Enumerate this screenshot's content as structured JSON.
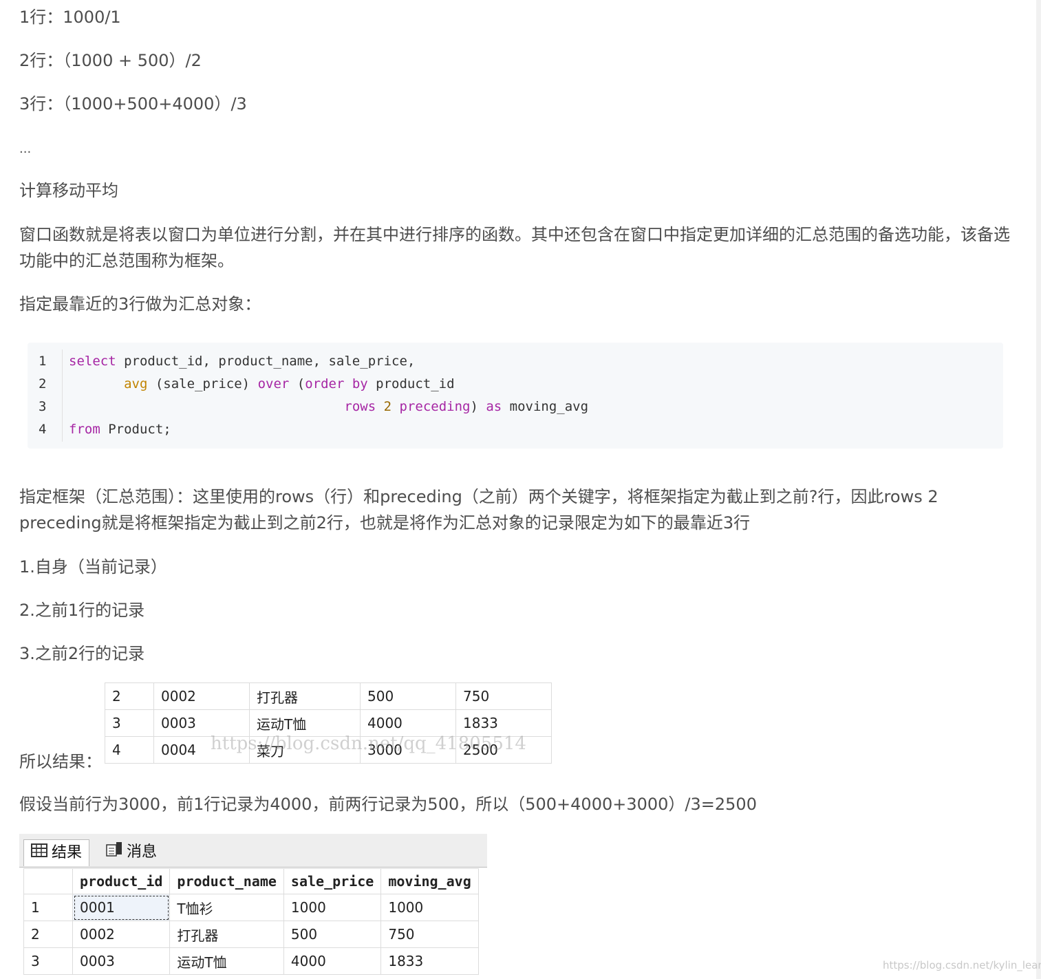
{
  "lines": {
    "l1": "1行：1000/1",
    "l2": "2行：（1000 + 500）/2",
    "l3": "3行：（1000+500+4000）/3",
    "ellipsis": "...",
    "heading": "计算移动平均",
    "para1": "窗口函数就是将表以窗口为单位进行分割，并在其中进行排序的函数。其中还包含在窗口中指定更加详细的汇总范围的备选功能，该备选功能中的汇总范围称为框架。",
    "intro": "指定最靠近的3行做为汇总对象：",
    "para2": "指定框架（汇总范围）：这里使用的rows（行）和preceding（之前）两个关键字，将框架指定为截止到之前?行，因此rows 2 preceding就是将框架指定为截止到之前2行，也就是将作为汇总对象的记录限定为如下的最靠近3行",
    "item1": "1.自身（当前记录）",
    "item2": "2.之前1行的记录",
    "item3": "3.之前2行的记录",
    "result_label": "所以结果：",
    "explain": "假设当前行为3000，前1行记录为4000，前两行记录为500，所以（500+4000+3000）/3=2500"
  },
  "code": {
    "line_numbers": [
      "1",
      "2",
      "3",
      "4"
    ],
    "l1_kw": "select",
    "l1_rest": " product_id, product_name, sale_price,",
    "l2_indent": "       ",
    "l2_fn": "avg",
    "l2_mid": " (sale_price) ",
    "l2_over": "over",
    "l2_paren": " (",
    "l2_order": "order by",
    "l2_rest": " product_id",
    "l3_indent": "                                   ",
    "l3_rows": "rows",
    "l3_sp": " ",
    "l3_num": "2",
    "l3_sp2": " ",
    "l3_prec": "preceding",
    "l3_mid": ") ",
    "l3_as": "as",
    "l3_rest": " moving_avg",
    "l4_kw": "from",
    "l4_rest": " Product;"
  },
  "small_table": {
    "rows": [
      [
        "2",
        "0002",
        "打孔器",
        "500",
        "750"
      ],
      [
        "3",
        "0003",
        "运动T恤",
        "4000",
        "1833"
      ],
      [
        "4",
        "0004",
        "菜刀",
        "3000",
        "2500"
      ]
    ],
    "watermark": "https://blog.csdn.net/qq_41805514"
  },
  "ssms": {
    "tab_results": "结果",
    "tab_messages": "消息",
    "columns": [
      "product_id",
      "product_name",
      "sale_price",
      "moving_avg"
    ],
    "rows": [
      [
        "1",
        "0001",
        "T恤衫",
        "1000",
        "1000"
      ],
      [
        "2",
        "0002",
        "打孔器",
        "500",
        "750"
      ],
      [
        "3",
        "0003",
        "运动T恤",
        "4000",
        "1833"
      ]
    ]
  },
  "corner_watermark": "https://blog.csdn.net/kylin_learn"
}
